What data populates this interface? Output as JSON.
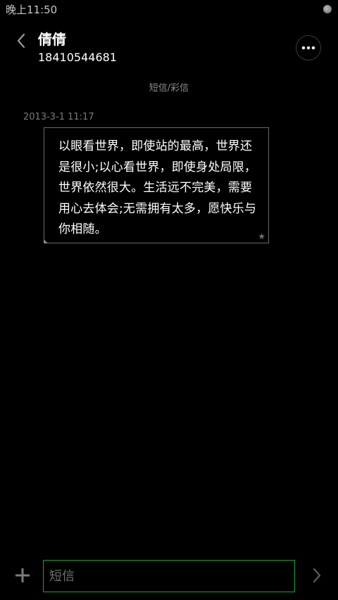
{
  "status_bar": {
    "time": "晚上11:50",
    "indicator_icon": "status-dot-icon"
  },
  "header": {
    "contact_name": "倩倩",
    "contact_number": "18410544681",
    "back_icon": "chevron-left-icon",
    "more_icon": "more-dots-icon"
  },
  "conversation": {
    "message_type": "短信/彩信",
    "messages": [
      {
        "timestamp": "2013-3-1 11:17",
        "text": "以眼看世界，即使站的最高，世界还是很小;以心看世界，即使身处局限，世界依然很大。生活远不完美，需要用心去体会;无需拥有太多，愿快乐与你相随。",
        "star_icon": "★"
      }
    ]
  },
  "composer": {
    "add_icon": "plus-icon",
    "placeholder": "短信",
    "value": "",
    "send_icon": "chevron-right-icon"
  },
  "colors": {
    "background": "#000000",
    "input_border": "#1fa33a",
    "bubble_border": "#6a6a6a"
  }
}
